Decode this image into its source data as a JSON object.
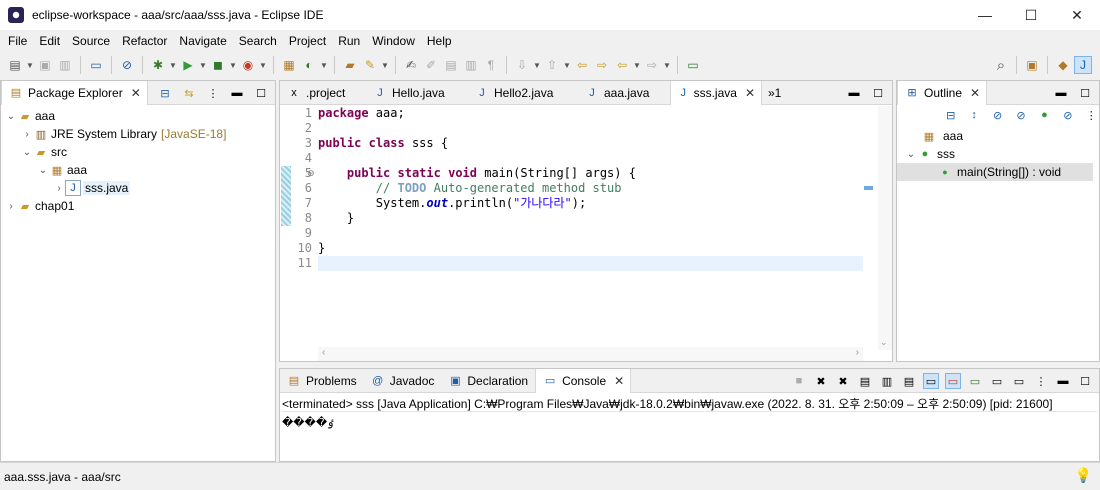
{
  "window": {
    "title": "eclipse-workspace - aaa/src/aaa/sss.java - Eclipse IDE",
    "minimize": "—",
    "maximize": "☐",
    "close": "✕"
  },
  "menu": [
    "File",
    "Edit",
    "Source",
    "Refactor",
    "Navigate",
    "Search",
    "Project",
    "Run",
    "Window",
    "Help"
  ],
  "package_explorer": {
    "tab_label": "Package Explorer",
    "tree": [
      {
        "label": "aaa",
        "level": 0,
        "expanded": true,
        "icon": "project-icon"
      },
      {
        "label": "JRE System Library",
        "suffix": "[JavaSE-18]",
        "level": 1,
        "expanded": false,
        "icon": "library-icon"
      },
      {
        "label": "src",
        "level": 1,
        "expanded": true,
        "icon": "source-folder-icon"
      },
      {
        "label": "aaa",
        "level": 2,
        "expanded": true,
        "icon": "package-icon"
      },
      {
        "label": "sss.java",
        "level": 3,
        "expanded": false,
        "icon": "java-file-icon",
        "selected": true
      },
      {
        "label": "chap01",
        "level": 0,
        "expanded": false,
        "icon": "project-icon"
      }
    ]
  },
  "editor": {
    "tabs": [
      {
        "label": ".project",
        "active": false
      },
      {
        "label": "Hello.java",
        "active": false
      },
      {
        "label": "Hello2.java",
        "active": false
      },
      {
        "label": "aaa.java",
        "active": false
      },
      {
        "label": "sss.java",
        "active": true
      }
    ],
    "overflow": "»1",
    "line_numbers": [
      "1",
      "2",
      "3",
      "4",
      "5",
      "6",
      "7",
      "8",
      "9",
      "10",
      "11"
    ],
    "code": {
      "l1_kw": "package",
      "l1_rest": " aaa;",
      "l3_kw1": "public",
      "l3_kw2": "class",
      "l3_rest": " sss {",
      "l5_indent": "    ",
      "l5_kw1": "public",
      "l5_kw2": "static",
      "l5_kw3": "void",
      "l5_rest": " main(String[] args) {",
      "l6_indent": "        ",
      "l6_cm1": "// ",
      "l6_todo": "TODO",
      "l6_cm2": " Auto-generated method stub",
      "l7_indent": "        ",
      "l7_a": "System.",
      "l7_field": "out",
      "l7_b": ".println(",
      "l7_str": "\"가나다라\"",
      "l7_c": ");",
      "l8": "    }",
      "l10": "}"
    }
  },
  "outline": {
    "tab_label": "Outline",
    "items": [
      {
        "label": "aaa",
        "icon": "package-icon"
      },
      {
        "label": "sss",
        "icon": "class-icon"
      },
      {
        "label": "main(String[]) : void",
        "icon": "public-method-icon"
      }
    ]
  },
  "console_panel": {
    "tabs": [
      {
        "label": "Problems",
        "active": false
      },
      {
        "label": "Javadoc",
        "active": false
      },
      {
        "label": "Declaration",
        "active": false
      },
      {
        "label": "Console",
        "active": true
      }
    ],
    "header": "<terminated> sss [Java Application] C:₩Program Files₩Java₩jdk-18.0.2₩bin₩javaw.exe  (2022. 8. 31. 오후 2:50:09 – 오후 2:50:09) [pid: 21600]",
    "output": "����ٶ"
  },
  "status": {
    "text": "aaa.sss.java - aaa/src"
  },
  "colors": {
    "keyword": "#7f0055",
    "comment": "#3f7f5f",
    "string": "#2a00ff",
    "field": "#0000c0"
  }
}
